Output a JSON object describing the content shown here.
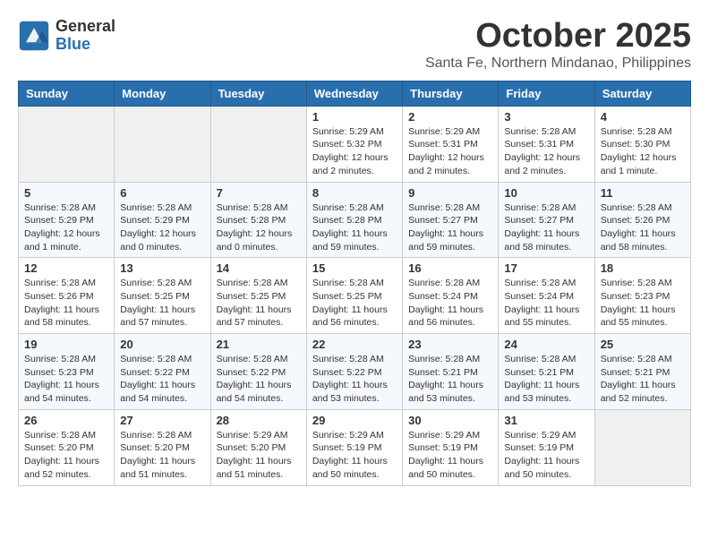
{
  "logo": {
    "general": "General",
    "blue": "Blue"
  },
  "title": "October 2025",
  "location": "Santa Fe, Northern Mindanao, Philippines",
  "days_of_week": [
    "Sunday",
    "Monday",
    "Tuesday",
    "Wednesday",
    "Thursday",
    "Friday",
    "Saturday"
  ],
  "weeks": [
    [
      {
        "day": "",
        "info": ""
      },
      {
        "day": "",
        "info": ""
      },
      {
        "day": "",
        "info": ""
      },
      {
        "day": "1",
        "info": "Sunrise: 5:29 AM\nSunset: 5:32 PM\nDaylight: 12 hours\nand 2 minutes."
      },
      {
        "day": "2",
        "info": "Sunrise: 5:29 AM\nSunset: 5:31 PM\nDaylight: 12 hours\nand 2 minutes."
      },
      {
        "day": "3",
        "info": "Sunrise: 5:28 AM\nSunset: 5:31 PM\nDaylight: 12 hours\nand 2 minutes."
      },
      {
        "day": "4",
        "info": "Sunrise: 5:28 AM\nSunset: 5:30 PM\nDaylight: 12 hours\nand 1 minute."
      }
    ],
    [
      {
        "day": "5",
        "info": "Sunrise: 5:28 AM\nSunset: 5:29 PM\nDaylight: 12 hours\nand 1 minute."
      },
      {
        "day": "6",
        "info": "Sunrise: 5:28 AM\nSunset: 5:29 PM\nDaylight: 12 hours\nand 0 minutes."
      },
      {
        "day": "7",
        "info": "Sunrise: 5:28 AM\nSunset: 5:28 PM\nDaylight: 12 hours\nand 0 minutes."
      },
      {
        "day": "8",
        "info": "Sunrise: 5:28 AM\nSunset: 5:28 PM\nDaylight: 11 hours\nand 59 minutes."
      },
      {
        "day": "9",
        "info": "Sunrise: 5:28 AM\nSunset: 5:27 PM\nDaylight: 11 hours\nand 59 minutes."
      },
      {
        "day": "10",
        "info": "Sunrise: 5:28 AM\nSunset: 5:27 PM\nDaylight: 11 hours\nand 58 minutes."
      },
      {
        "day": "11",
        "info": "Sunrise: 5:28 AM\nSunset: 5:26 PM\nDaylight: 11 hours\nand 58 minutes."
      }
    ],
    [
      {
        "day": "12",
        "info": "Sunrise: 5:28 AM\nSunset: 5:26 PM\nDaylight: 11 hours\nand 58 minutes."
      },
      {
        "day": "13",
        "info": "Sunrise: 5:28 AM\nSunset: 5:25 PM\nDaylight: 11 hours\nand 57 minutes."
      },
      {
        "day": "14",
        "info": "Sunrise: 5:28 AM\nSunset: 5:25 PM\nDaylight: 11 hours\nand 57 minutes."
      },
      {
        "day": "15",
        "info": "Sunrise: 5:28 AM\nSunset: 5:25 PM\nDaylight: 11 hours\nand 56 minutes."
      },
      {
        "day": "16",
        "info": "Sunrise: 5:28 AM\nSunset: 5:24 PM\nDaylight: 11 hours\nand 56 minutes."
      },
      {
        "day": "17",
        "info": "Sunrise: 5:28 AM\nSunset: 5:24 PM\nDaylight: 11 hours\nand 55 minutes."
      },
      {
        "day": "18",
        "info": "Sunrise: 5:28 AM\nSunset: 5:23 PM\nDaylight: 11 hours\nand 55 minutes."
      }
    ],
    [
      {
        "day": "19",
        "info": "Sunrise: 5:28 AM\nSunset: 5:23 PM\nDaylight: 11 hours\nand 54 minutes."
      },
      {
        "day": "20",
        "info": "Sunrise: 5:28 AM\nSunset: 5:22 PM\nDaylight: 11 hours\nand 54 minutes."
      },
      {
        "day": "21",
        "info": "Sunrise: 5:28 AM\nSunset: 5:22 PM\nDaylight: 11 hours\nand 54 minutes."
      },
      {
        "day": "22",
        "info": "Sunrise: 5:28 AM\nSunset: 5:22 PM\nDaylight: 11 hours\nand 53 minutes."
      },
      {
        "day": "23",
        "info": "Sunrise: 5:28 AM\nSunset: 5:21 PM\nDaylight: 11 hours\nand 53 minutes."
      },
      {
        "day": "24",
        "info": "Sunrise: 5:28 AM\nSunset: 5:21 PM\nDaylight: 11 hours\nand 53 minutes."
      },
      {
        "day": "25",
        "info": "Sunrise: 5:28 AM\nSunset: 5:21 PM\nDaylight: 11 hours\nand 52 minutes."
      }
    ],
    [
      {
        "day": "26",
        "info": "Sunrise: 5:28 AM\nSunset: 5:20 PM\nDaylight: 11 hours\nand 52 minutes."
      },
      {
        "day": "27",
        "info": "Sunrise: 5:28 AM\nSunset: 5:20 PM\nDaylight: 11 hours\nand 51 minutes."
      },
      {
        "day": "28",
        "info": "Sunrise: 5:29 AM\nSunset: 5:20 PM\nDaylight: 11 hours\nand 51 minutes."
      },
      {
        "day": "29",
        "info": "Sunrise: 5:29 AM\nSunset: 5:19 PM\nDaylight: 11 hours\nand 50 minutes."
      },
      {
        "day": "30",
        "info": "Sunrise: 5:29 AM\nSunset: 5:19 PM\nDaylight: 11 hours\nand 50 minutes."
      },
      {
        "day": "31",
        "info": "Sunrise: 5:29 AM\nSunset: 5:19 PM\nDaylight: 11 hours\nand 50 minutes."
      },
      {
        "day": "",
        "info": ""
      }
    ]
  ]
}
